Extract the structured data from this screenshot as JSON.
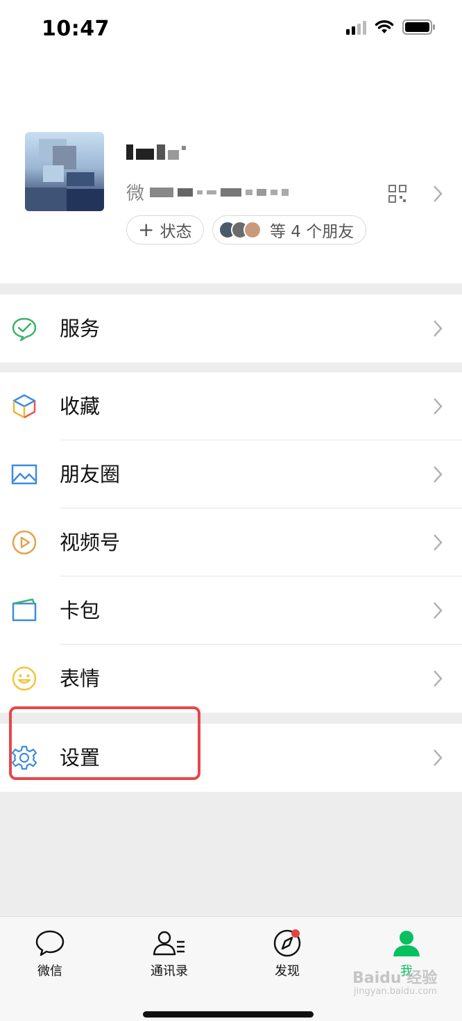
{
  "status_bar": {
    "time": "10:47"
  },
  "profile": {
    "wxid_label": "微",
    "status_pill": "状态",
    "friends_pill": "等 4 个朋友"
  },
  "menu": {
    "group1": [
      {
        "label": "服务",
        "icon": "wechat-pay-check-icon"
      }
    ],
    "group2": [
      {
        "label": "收藏",
        "icon": "cube-icon"
      },
      {
        "label": "朋友圈",
        "icon": "picture-icon"
      },
      {
        "label": "视频号",
        "icon": "play-circle-icon"
      },
      {
        "label": "卡包",
        "icon": "card-wallet-icon"
      },
      {
        "label": "表情",
        "icon": "smiley-icon"
      }
    ],
    "group3": [
      {
        "label": "设置",
        "icon": "gear-icon"
      }
    ]
  },
  "tabbar": {
    "tabs": [
      {
        "label": "微信",
        "icon": "chat-bubble-icon"
      },
      {
        "label": "通讯录",
        "icon": "contacts-icon"
      },
      {
        "label": "发现",
        "icon": "compass-icon"
      },
      {
        "label": "我",
        "icon": "person-icon"
      }
    ],
    "active_color": "#07c160",
    "badge_color": "#e64340"
  },
  "watermark": {
    "brand": "Baidu 经验",
    "url": "jingyan.baidu.com"
  },
  "colors": {
    "highlight": "#e5474b"
  }
}
